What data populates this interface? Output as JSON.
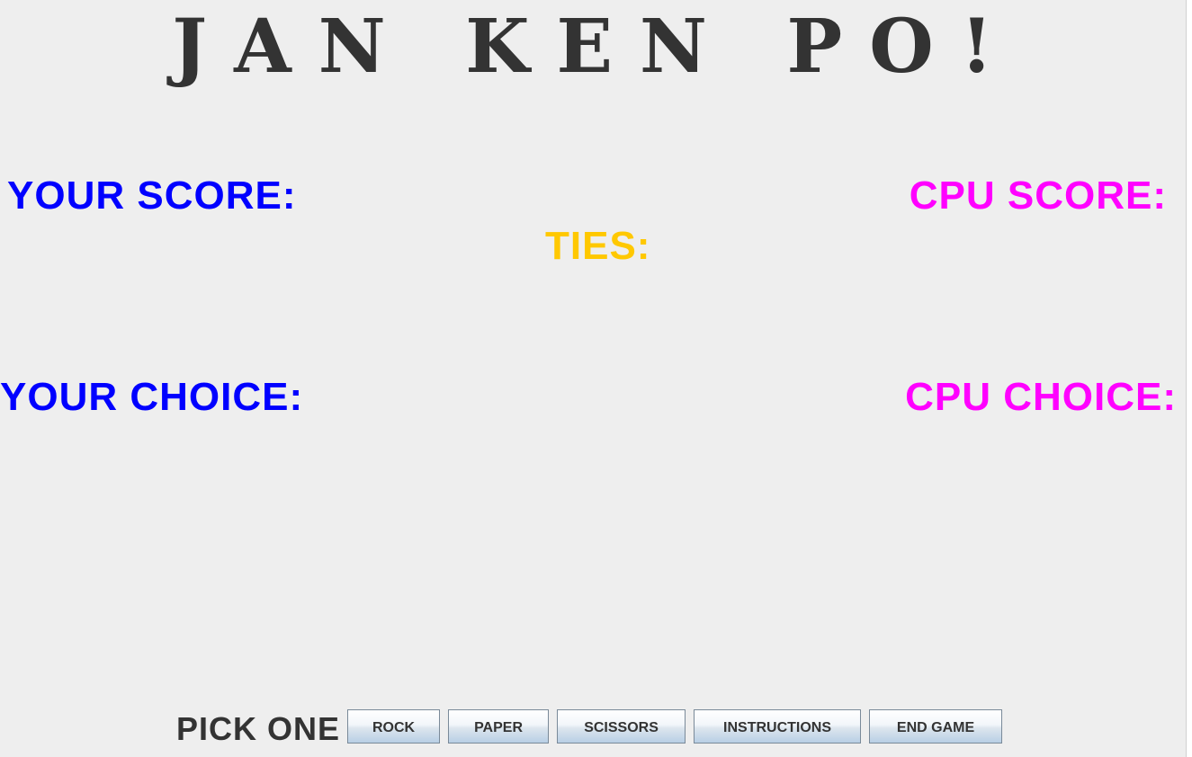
{
  "title": "JAN KEN PO!",
  "scores": {
    "your_score_label": "YOUR SCORE:",
    "cpu_score_label": "CPU SCORE:",
    "ties_label": "TIES:"
  },
  "choices": {
    "your_choice_label": "YOUR CHOICE:",
    "cpu_choice_label": "CPU CHOICE:"
  },
  "controls": {
    "prompt": "PICK ONE",
    "buttons": {
      "rock": "ROCK",
      "paper": "PAPER",
      "scissors": "SCISSORS",
      "instructions": "INSTRUCTIONS",
      "end_game": "END GAME"
    }
  },
  "colors": {
    "background": "#eeeeee",
    "title": "#333333",
    "player": "#0000ff",
    "cpu": "#ff00ff",
    "ties": "#ffc800",
    "prompt": "#333333"
  }
}
